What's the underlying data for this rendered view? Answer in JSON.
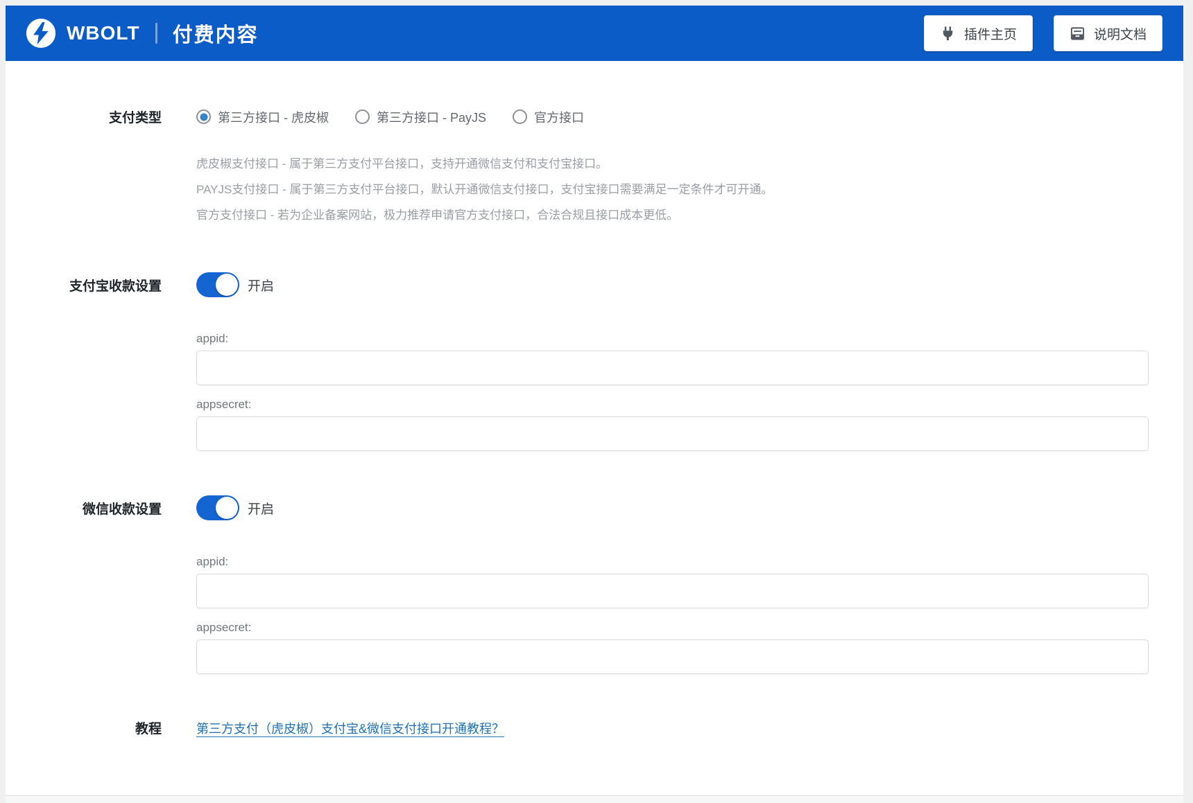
{
  "header": {
    "brand": "WBOLT",
    "title": "付费内容",
    "buttons": [
      {
        "icon": "plug-icon",
        "label": "插件主页"
      },
      {
        "icon": "doc-icon",
        "label": "说明文档"
      }
    ]
  },
  "form": {
    "payment_type": {
      "label": "支付类型",
      "options": [
        {
          "label": "第三方接口 - 虎皮椒",
          "selected": true
        },
        {
          "label": "第三方接口 - PayJS",
          "selected": false
        },
        {
          "label": "官方接口",
          "selected": false
        }
      ],
      "descriptions": [
        "虎皮椒支付接口 - 属于第三方支付平台接口，支持开通微信支付和支付宝接口。",
        "PAYJS支付接口 - 属于第三方支付平台接口，默认开通微信支付接口，支付宝接口需要满足一定条件才可开通。",
        "官方支付接口 - 若为企业备案网站，极力推荐申请官方支付接口，合法合规且接口成本更低。"
      ]
    },
    "alipay": {
      "label": "支付宝收款设置",
      "toggle_state": "on",
      "toggle_label": "开启",
      "fields": [
        {
          "label": "appid:",
          "value": ""
        },
        {
          "label": "appsecret:",
          "value": ""
        }
      ]
    },
    "wechat": {
      "label": "微信收款设置",
      "toggle_state": "on",
      "toggle_label": "开启",
      "fields": [
        {
          "label": "appid:",
          "value": ""
        },
        {
          "label": "appsecret:",
          "value": ""
        }
      ]
    },
    "tutorial": {
      "label": "教程",
      "link_text": "第三方支付（虎皮椒）支付宝&微信支付接口开通教程？"
    }
  },
  "colors": {
    "header_blue": "#0b5cc7",
    "toggle_blue": "#1464d2",
    "radio_blue": "#3582c4",
    "link_blue": "#2271b1",
    "page_bg": "#f0f0f1"
  }
}
